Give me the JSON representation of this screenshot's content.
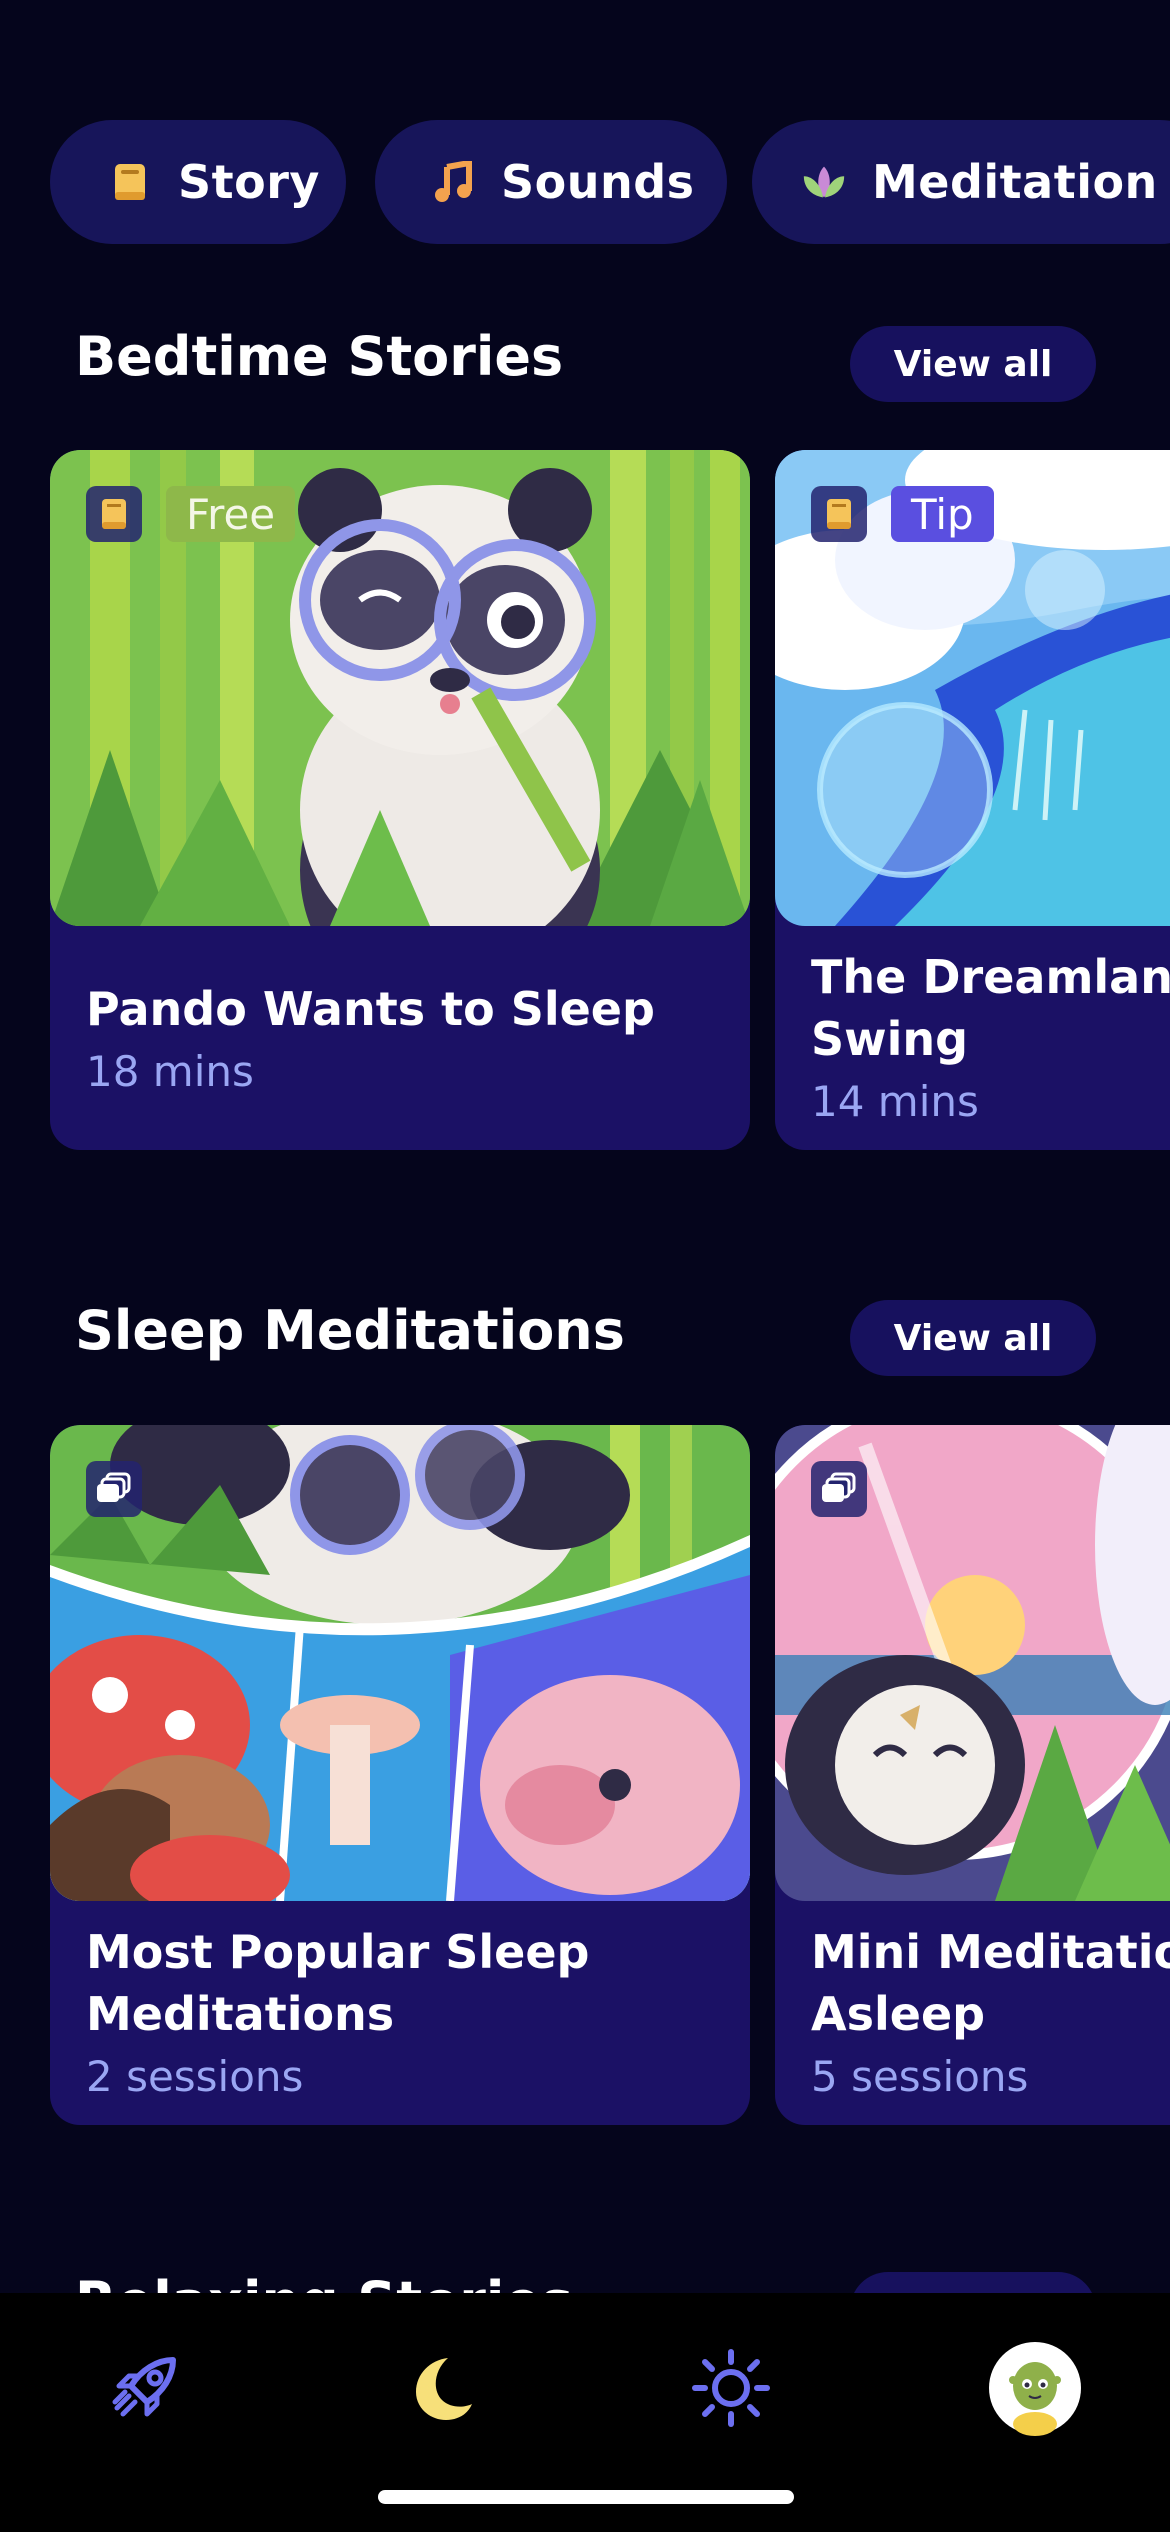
{
  "chips": [
    {
      "label": "Story",
      "icon": "book-icon",
      "icon_color": "#f5c45a"
    },
    {
      "label": "Sounds",
      "icon": "music-note-icon",
      "icon_color": "#f3a24e"
    },
    {
      "label": "Meditation",
      "icon": "lotus-icon",
      "icon_color": "#9fd37a"
    }
  ],
  "sections": [
    {
      "title": "Bedtime Stories",
      "view_all": "View all",
      "cards": [
        {
          "title": "Pando Wants to Sleep",
          "title_line2": "",
          "subtitle": "18 mins",
          "badge": "Free",
          "badge_icon": "book-icon"
        },
        {
          "title": "The Dreamland",
          "title_line2": "Swing",
          "subtitle": "14 mins",
          "badge": "Tip",
          "badge_icon": "book-icon"
        }
      ]
    },
    {
      "title": "Sleep Meditations",
      "view_all": "View all",
      "cards": [
        {
          "title": "Most Popular Sleep",
          "title_line2": "Meditations",
          "subtitle": "2 sessions",
          "badge_icon": "stack-icon"
        },
        {
          "title": "Mini Meditation",
          "title_line2": "Asleep",
          "subtitle": "5 sessions",
          "badge_icon": "stack-icon"
        }
      ]
    }
  ],
  "peek_section": {
    "title": "Relaxing Stories"
  },
  "tabs": [
    {
      "name": "explore",
      "icon": "rocket-icon",
      "active": false
    },
    {
      "name": "sleep",
      "icon": "moon-icon",
      "active": true
    },
    {
      "name": "day",
      "icon": "sun-icon",
      "active": false
    },
    {
      "name": "profile",
      "icon": "avatar-icon",
      "active": false
    }
  ],
  "colors": {
    "background": "#05051c",
    "chip_bg": "#17155a",
    "card_bg": "#1b1165",
    "subtitle": "#9aa6f3",
    "accent_moon": "#f7e07a",
    "inactive_icon": "#6c6ff0"
  }
}
